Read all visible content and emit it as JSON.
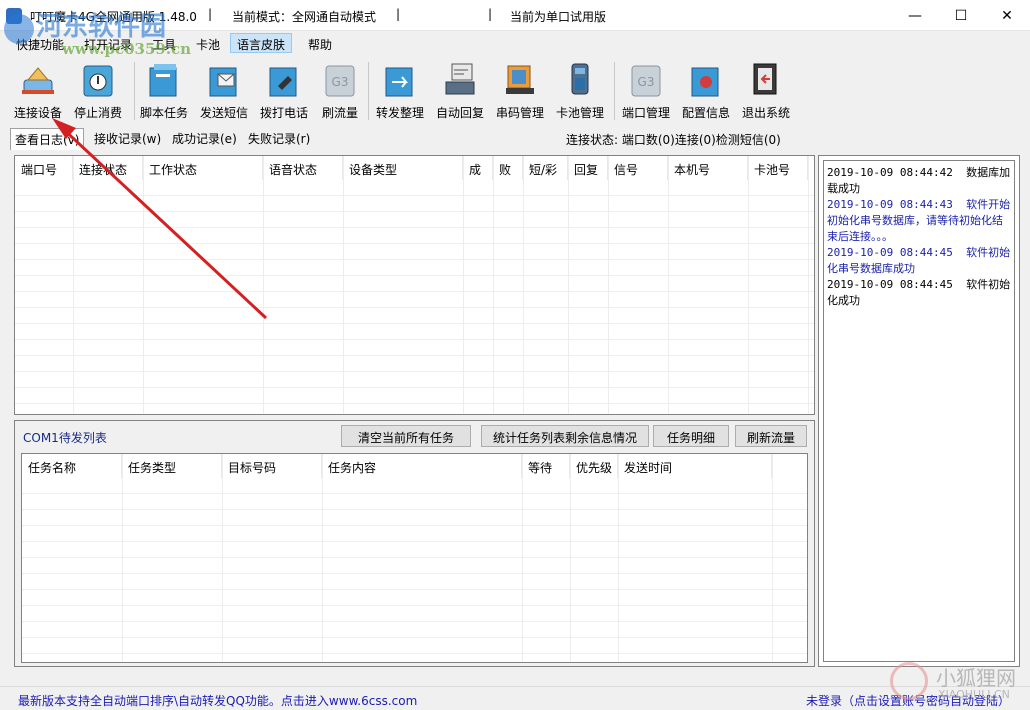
{
  "window": {
    "title": "叮叮魔卡4G全网通用版 1.48.0",
    "mode": "当前模式：全网通自动模式",
    "license": "当前为单口试用版",
    "controls": {
      "minimize": "—",
      "maximize": "☐",
      "close": "✕"
    }
  },
  "watermark": {
    "site_name": "河东软件园",
    "site_url": "www.pc0359.cn",
    "corner_name": "小狐狸网",
    "corner_url": "XIAOHULI.CN"
  },
  "menu": [
    {
      "label": "快捷功能",
      "active": false
    },
    {
      "label": "打开记录",
      "active": false
    },
    {
      "label": "工具",
      "active": false
    },
    {
      "label": "卡池",
      "active": false
    },
    {
      "label": "语言皮肤",
      "active": true
    },
    {
      "label": "帮助",
      "active": false
    }
  ],
  "toolbar": [
    {
      "label": "连接设备",
      "icon": "connect-device-icon"
    },
    {
      "label": "停止消费",
      "icon": "stop-icon"
    },
    {
      "label": "脚本任务",
      "icon": "script-folder-icon"
    },
    {
      "label": "发送短信",
      "icon": "send-sms-icon"
    },
    {
      "label": "拨打电话",
      "icon": "dial-phone-icon"
    },
    {
      "label": "刷流量",
      "icon": "g3-traffic-icon"
    },
    {
      "label": "转发整理",
      "icon": "forward-icon"
    },
    {
      "label": "自动回复",
      "icon": "auto-reply-icon"
    },
    {
      "label": "串码管理",
      "icon": "imei-manage-icon"
    },
    {
      "label": "卡池管理",
      "icon": "card-pool-icon"
    },
    {
      "label": "端口管理",
      "icon": "g3-port-icon"
    },
    {
      "label": "配置信息",
      "icon": "config-info-icon"
    },
    {
      "label": "退出系统",
      "icon": "exit-icon"
    }
  ],
  "tabs": [
    {
      "label": "查看日志(v)",
      "active": true
    },
    {
      "label": "接收记录(w)",
      "active": false
    },
    {
      "label": "成功记录(e)",
      "active": false
    },
    {
      "label": "失败记录(r)",
      "active": false
    }
  ],
  "connection_status": "连接状态:  端口数(0)连接(0)检测短信(0)",
  "ports_table": {
    "columns": [
      "端口号",
      "连接状态",
      "工作状态",
      "语音状态",
      "设备类型",
      "成",
      "败",
      "短/彩",
      "回复",
      "信号",
      "本机号",
      "卡池号"
    ],
    "rows": []
  },
  "task_section": {
    "title": "COM1待发列表",
    "buttons": [
      "清空当前所有任务",
      "统计任务列表剩余信息情况",
      "任务明细",
      "刷新流量"
    ],
    "columns": [
      "任务名称",
      "任务类型",
      "目标号码",
      "任务内容",
      "等待",
      "优先级",
      "发送时间"
    ],
    "rows": []
  },
  "log": [
    {
      "text": "2019-10-09 08:44:42  数据库加载成功",
      "color": "#000000"
    },
    {
      "text": "2019-10-09 08:44:43  软件开始初始化串号数据库，请等待初始化结束后连接。。。",
      "color": "#1c22a8"
    },
    {
      "text": "2019-10-09 08:44:45  软件初始化串号数据库成功",
      "color": "#1c22a8"
    },
    {
      "text": "2019-10-09 08:44:45  软件初始化成功",
      "color": "#000000"
    }
  ],
  "status_bar": {
    "left": "最新版本支持全自动端口排序\\自动转发QQ功能。点击进入www.6css.com",
    "right": "未登录（点击设置账号密码自动登陆）"
  },
  "colors": {
    "menu_active_bg": "#cce4f7",
    "status_text": "#1b1bb3",
    "annotation_arrow": "#d42020"
  }
}
